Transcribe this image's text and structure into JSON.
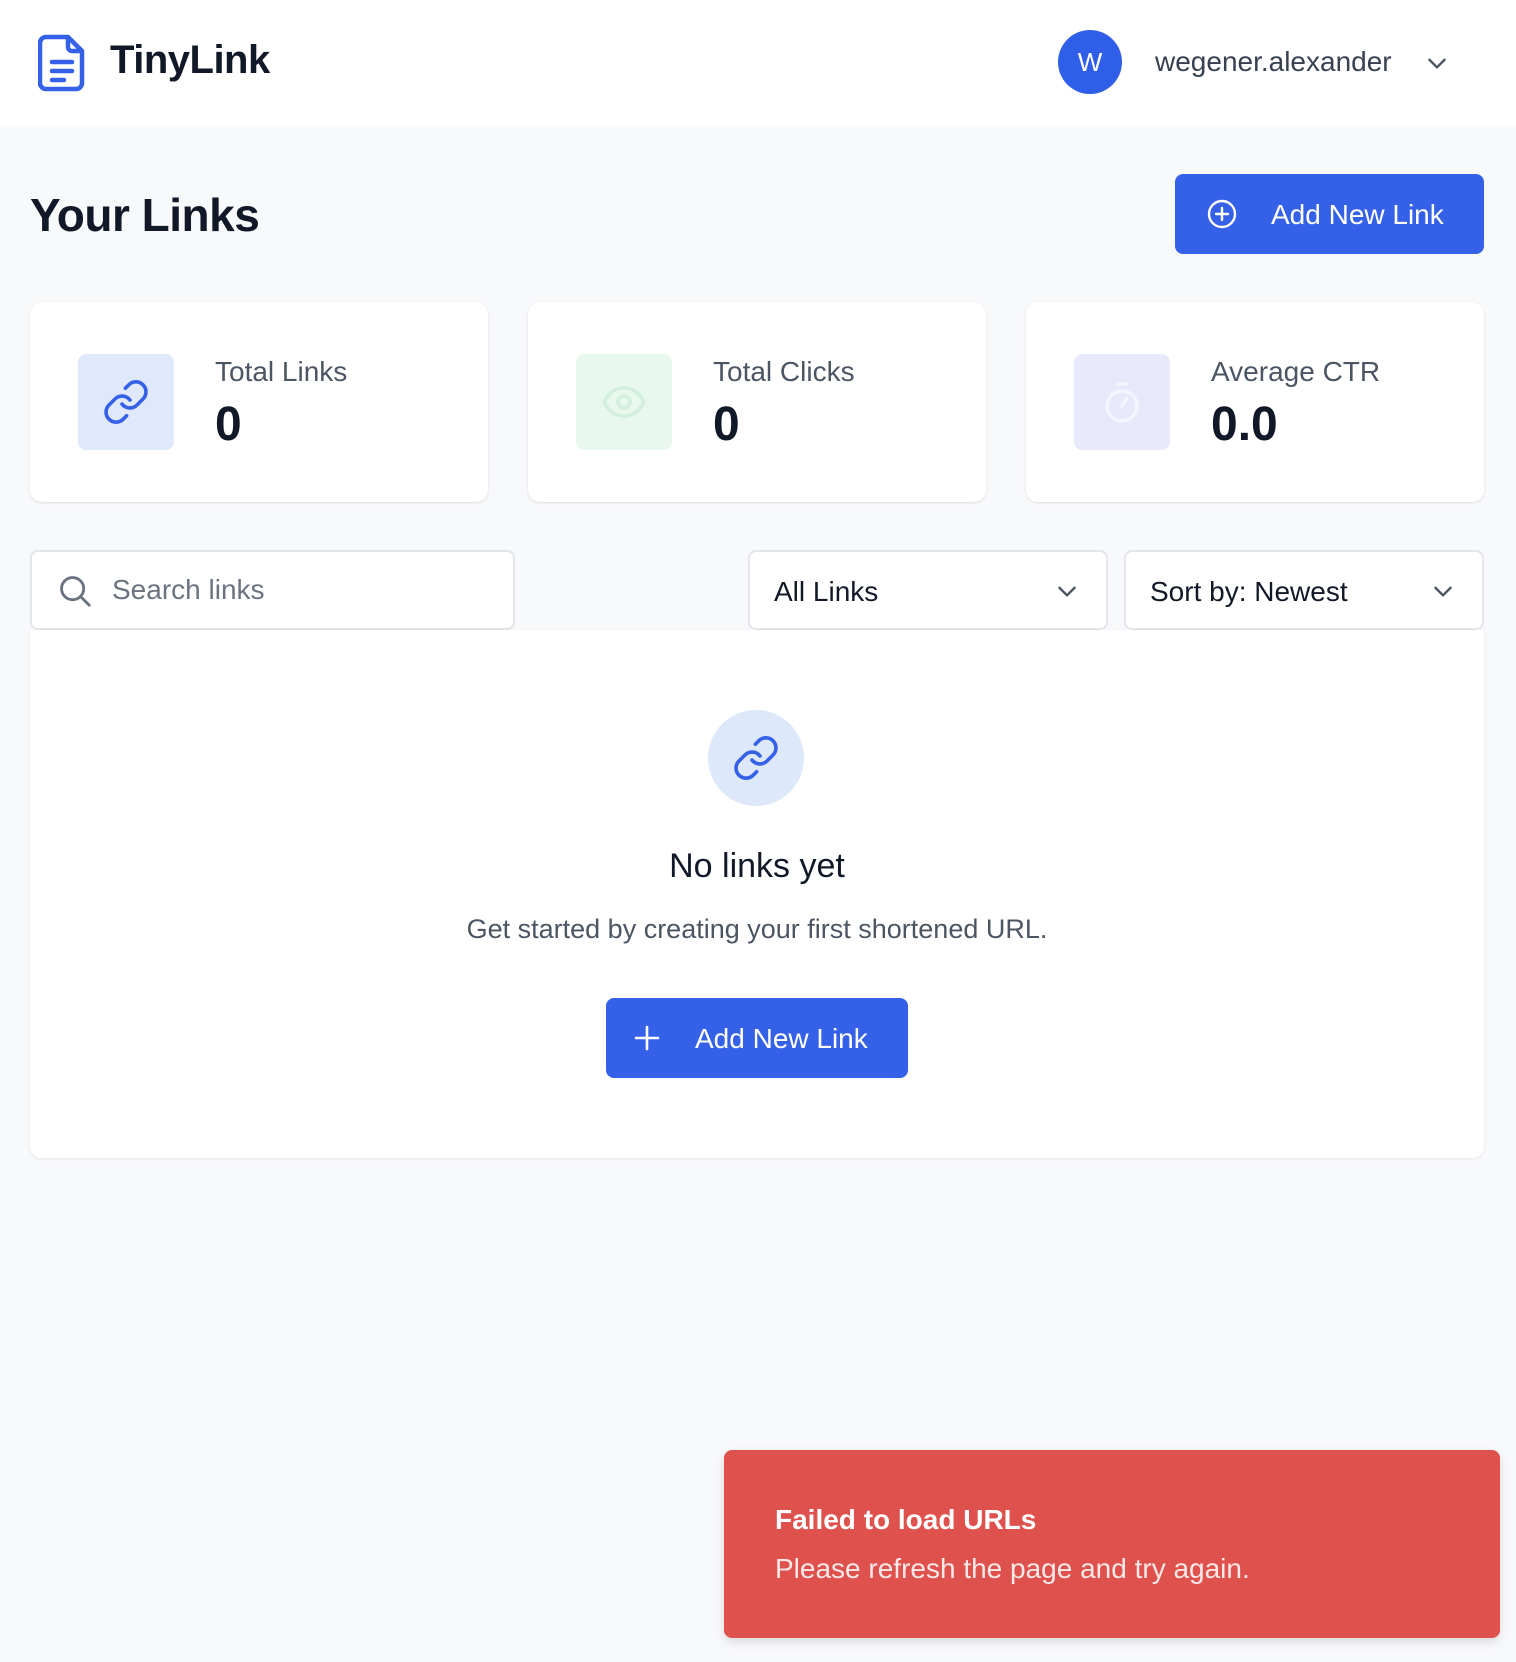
{
  "app": {
    "name": "TinyLink",
    "brand_color": "#3461e8",
    "logo_icon": "document-icon"
  },
  "user": {
    "initial": "W",
    "username": "wegener.alexander",
    "menu_icon": "chevron-down-icon"
  },
  "page": {
    "title": "Your Links",
    "add_button_label": "Add New Link",
    "add_button_icon": "plus-circle-icon"
  },
  "stats": [
    {
      "label": "Total Links",
      "value": "0",
      "icon": "link-icon",
      "icon_bg": "#e0e9fb",
      "icon_color": "#3461e8"
    },
    {
      "label": "Total Clicks",
      "value": "0",
      "icon": "eye-icon",
      "icon_bg": "#e8f8ee",
      "icon_color": "#d9f2e1"
    },
    {
      "label": "Average CTR",
      "value": "0.0",
      "icon": "stopwatch-icon",
      "icon_bg": "#e7e9fb",
      "icon_color": "#f3f4ff"
    }
  ],
  "filters": {
    "search_placeholder": "Search links",
    "search_value": "",
    "type_select": "All Links",
    "sort_select": "Sort by: Newest"
  },
  "empty_state": {
    "icon": "link-icon",
    "title": "No links yet",
    "description": "Get started by creating your first shortened URL.",
    "button_label": "Add New Link",
    "button_icon": "plus-icon"
  },
  "toast": {
    "title": "Failed to load URLs",
    "message": "Please refresh the page and try again.",
    "color": "#de514d"
  }
}
